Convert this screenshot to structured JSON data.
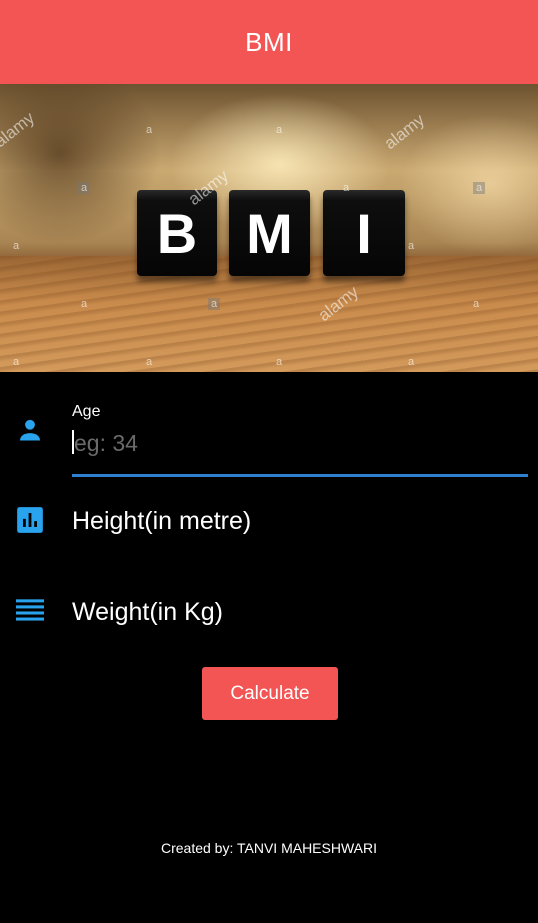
{
  "appbar": {
    "title": "BMI"
  },
  "hero": {
    "blocks": [
      "B",
      "M",
      "I"
    ],
    "watermark": "alamy",
    "watermark_mark": "a"
  },
  "form": {
    "age": {
      "label": "Age",
      "placeholder": "eg: 34",
      "value": ""
    },
    "height": {
      "label": "Height(in metre)"
    },
    "weight": {
      "label": "Weight(in Kg)"
    },
    "calculate_label": "Calculate"
  },
  "footer": {
    "credit": "Created by: TANVI MAHESHWARI"
  },
  "colors": {
    "accent": "#F35454",
    "icon": "#29A3EE",
    "focus_underline": "#2F80D1",
    "background": "#000000"
  },
  "icons": {
    "age": "person-icon",
    "height": "bar-chart-icon",
    "weight": "list-lines-icon"
  }
}
